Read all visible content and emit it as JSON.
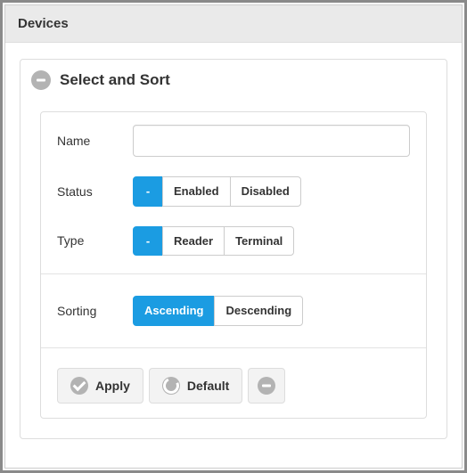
{
  "panel": {
    "title": "Devices"
  },
  "section": {
    "title": "Select and Sort"
  },
  "form": {
    "name_label": "Name",
    "name_value": "",
    "status_label": "Status",
    "status_options": {
      "any": "-",
      "enabled": "Enabled",
      "disabled": "Disabled"
    },
    "type_label": "Type",
    "type_options": {
      "any": "-",
      "reader": "Reader",
      "terminal": "Terminal"
    },
    "sorting_label": "Sorting",
    "sorting_options": {
      "asc": "Ascending",
      "desc": "Descending"
    }
  },
  "actions": {
    "apply": "Apply",
    "default": "Default"
  }
}
